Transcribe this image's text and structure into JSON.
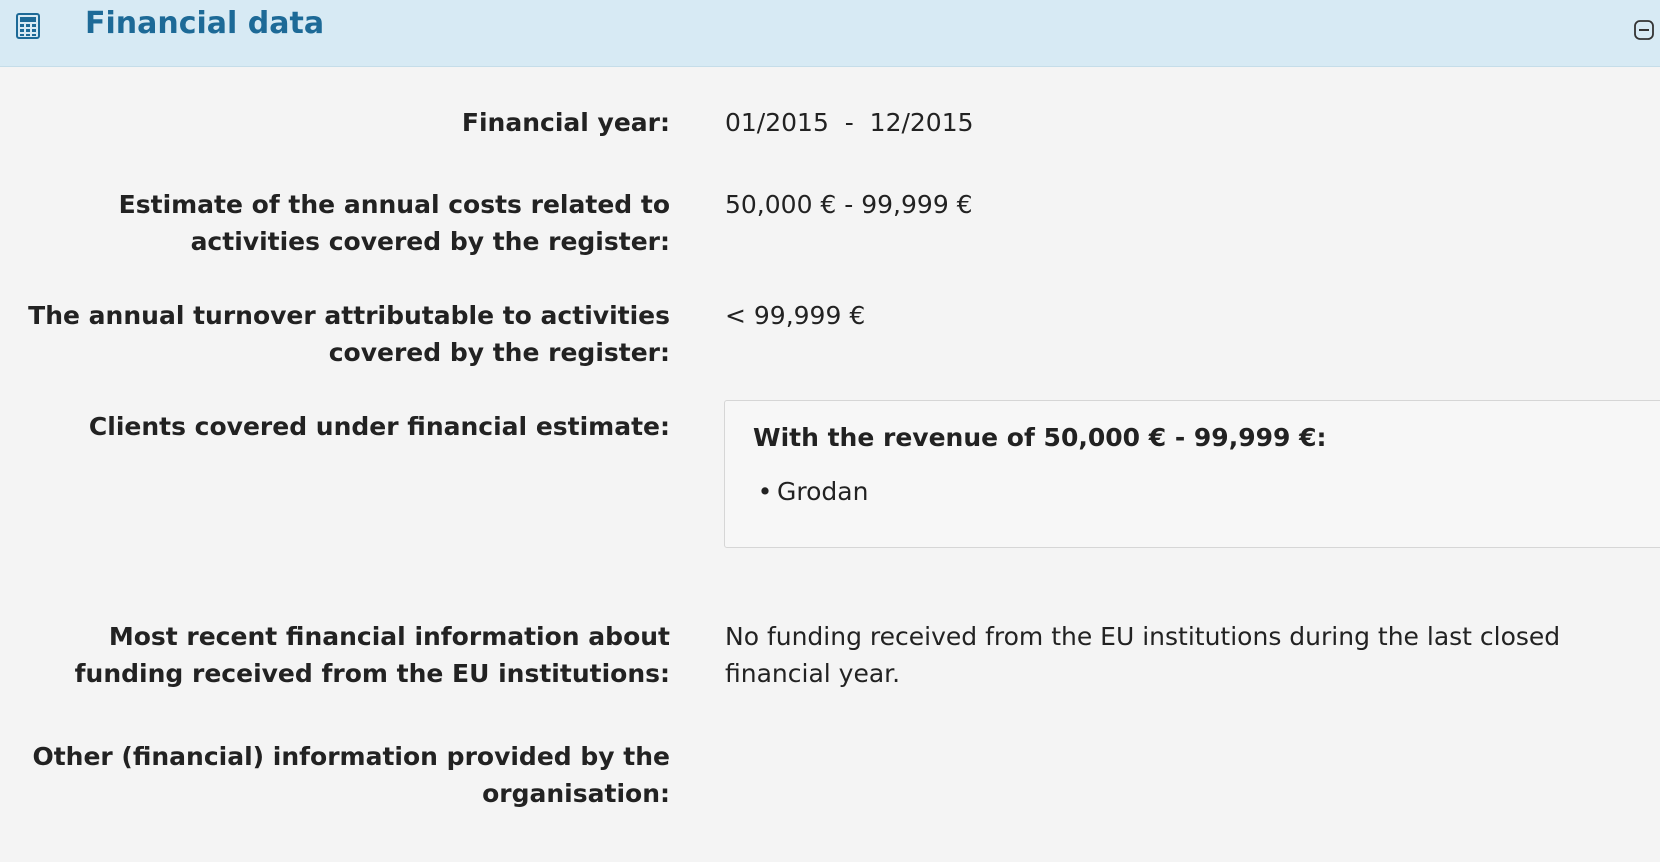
{
  "header": {
    "title": "Financial data",
    "icon": "calculator-icon",
    "collapse_icon": "collapse-minus-icon"
  },
  "rows": {
    "financial_year": {
      "label": "Financial year:",
      "value": "01/2015  -  12/2015"
    },
    "annual_costs": {
      "label_line1": "Estimate of the annual costs related to",
      "label_line2": "activities covered by the register:",
      "value": "50,000 € - 99,999 €"
    },
    "turnover": {
      "label_line1": "The annual turnover attributable to activities",
      "label_line2": "covered by the register:",
      "value": "< 99,999 €"
    },
    "clients": {
      "label": "Clients covered under financial estimate:",
      "box_heading": "With the revenue of 50,000 € - 99,999 €:",
      "items": [
        "Grodan"
      ]
    },
    "eu_funding": {
      "label_line1": "Most recent financial information about",
      "label_line2": "funding received from the EU institutions:",
      "value_line1": "No funding received from the EU institutions during the last closed",
      "value_line2": "financial year."
    },
    "other_info": {
      "label_line1": "Other (financial) information provided by the",
      "label_line2": "organisation:",
      "value": ""
    }
  },
  "colors": {
    "header_bg": "#d7eaf4",
    "header_text": "#1d6a97",
    "page_bg": "#f4f4f4"
  }
}
